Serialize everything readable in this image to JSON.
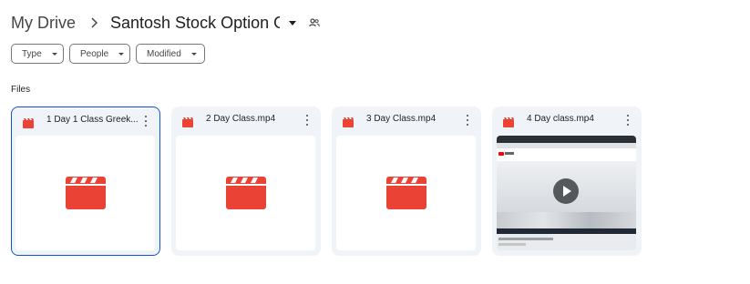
{
  "breadcrumb": {
    "root": "My Drive",
    "separator": "›",
    "current": "Santosh Stock Option O..."
  },
  "filters": [
    {
      "label": "Type"
    },
    {
      "label": "People"
    },
    {
      "label": "Modified"
    }
  ],
  "section": {
    "title": "Files"
  },
  "files": [
    {
      "name": "1 Day 1 Class Greek...",
      "icon": "video-file-icon",
      "thumbnail": "video-placeholder-icon",
      "selected": true
    },
    {
      "name": "2 Day Class.mp4",
      "icon": "video-file-icon",
      "thumbnail": "video-placeholder-icon",
      "selected": false
    },
    {
      "name": "3 Day Class.mp4",
      "icon": "video-file-icon",
      "thumbnail": "video-placeholder-icon",
      "selected": false
    },
    {
      "name": "4 Day class.mp4",
      "icon": "video-file-icon",
      "thumbnail": "video-screenshot",
      "selected": false
    }
  ],
  "colors": {
    "video_red": "#ea4335",
    "card_bg": "#f0f4f9",
    "selected_border": "#0b57d0"
  }
}
